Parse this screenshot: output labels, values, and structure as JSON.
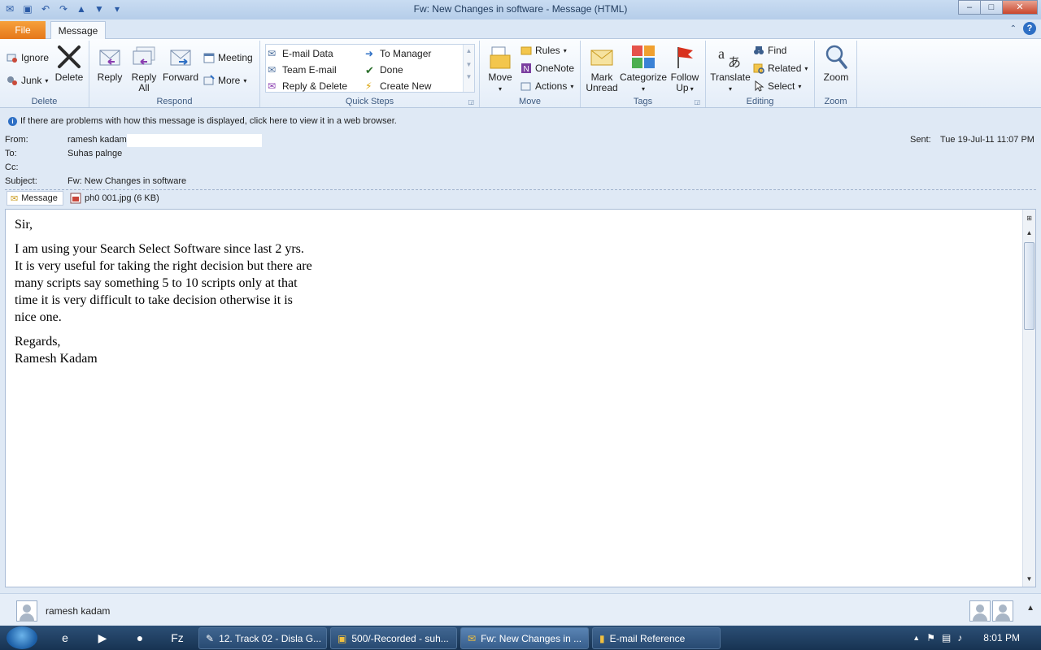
{
  "window": {
    "title": "Fw: New Changes in software  -  Message (HTML)",
    "minimize": "–",
    "maximize": "□",
    "close": "✕"
  },
  "tabs": {
    "file": "File",
    "message": "Message",
    "help": "?"
  },
  "ribbon": {
    "delete_group": {
      "label": "Delete",
      "ignore": "Ignore",
      "junk": "Junk",
      "delete": "Delete"
    },
    "respond_group": {
      "label": "Respond",
      "reply": "Reply",
      "reply_all_1": "Reply",
      "reply_all_2": "All",
      "forward": "Forward",
      "meeting": "Meeting",
      "more": "More"
    },
    "quick_steps": {
      "label": "Quick Steps",
      "items": [
        "E-mail Data",
        "To Manager",
        "Team E-mail",
        "Done",
        "Reply & Delete",
        "Create New"
      ]
    },
    "move_group": {
      "label": "Move",
      "move": "Move",
      "rules": "Rules",
      "onenote": "OneNote",
      "actions": "Actions"
    },
    "tags_group": {
      "label": "Tags",
      "mark_unread_1": "Mark",
      "mark_unread_2": "Unread",
      "categorize": "Categorize",
      "follow_up_1": "Follow",
      "follow_up_2": "Up"
    },
    "editing_group": {
      "label": "Editing",
      "translate": "Translate",
      "find": "Find",
      "related": "Related",
      "select": "Select"
    },
    "zoom_group": {
      "label": "Zoom",
      "zoom": "Zoom"
    }
  },
  "infobar": "If there are problems with how this message is displayed, click here to view it in a web browser.",
  "header": {
    "from_label": "From:",
    "from_value": "ramesh kadam",
    "to_label": "To:",
    "to_value": "Suhas palnge",
    "cc_label": "Cc:",
    "cc_value": "",
    "subject_label": "Subject:",
    "subject_value": "Fw: New Changes in software",
    "sent_label": "Sent:",
    "sent_value": "Tue 19-Jul-11 11:07 PM"
  },
  "attachments": {
    "message_tab": "Message",
    "file": "ph0 001.jpg (6 KB)"
  },
  "body": {
    "greeting": "Sir,",
    "lines": [
      "I am using your Search Select Software since last 2 yrs.",
      "It is very useful for taking the right decision but there are",
      "many scripts say something  5 to 10 scripts only at that",
      "time it is very difficult  to take decision otherwise it is",
      "nice one."
    ],
    "closing": "Regards,",
    "signature": "Ramesh Kadam"
  },
  "people_pane": {
    "name": "ramesh kadam"
  },
  "taskbar": {
    "items": [
      "12. Track 02 - Disla G...",
      "500/-Recorded - suh...",
      "Fw: New Changes in ...",
      "E-mail Reference"
    ],
    "clock": "8:01 PM"
  }
}
